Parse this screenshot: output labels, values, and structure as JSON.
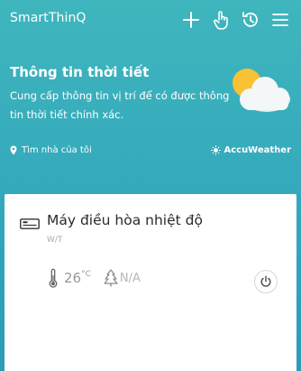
{
  "app": {
    "title": "SmartThinQ"
  },
  "appbar": {
    "icons": [
      "plus-icon",
      "hand-touch-icon",
      "history-icon",
      "menu-icon"
    ]
  },
  "weather": {
    "title": "Thông tin thời tiết",
    "description": "Cung cấp thông tin vị trí để có được thông tin thời tiết chính xác.",
    "icon": "sun-cloud-icon"
  },
  "location": {
    "label": "Tìm nhà của tôi",
    "icon": "location-pin-icon"
  },
  "provider": {
    "label": "AccuWeather",
    "icon": "accuweather-sun-icon"
  },
  "device": {
    "name": "Máy điều hòa nhiệt độ",
    "subtitle": "W/T",
    "icon": "air-conditioner-icon",
    "temperature": "26",
    "temperature_unit": "°C",
    "weather_value": "N/A"
  },
  "colors": {
    "background_top": "#3fb6bd",
    "background_bottom": "#2b9bb8",
    "card": "#ffffff"
  }
}
